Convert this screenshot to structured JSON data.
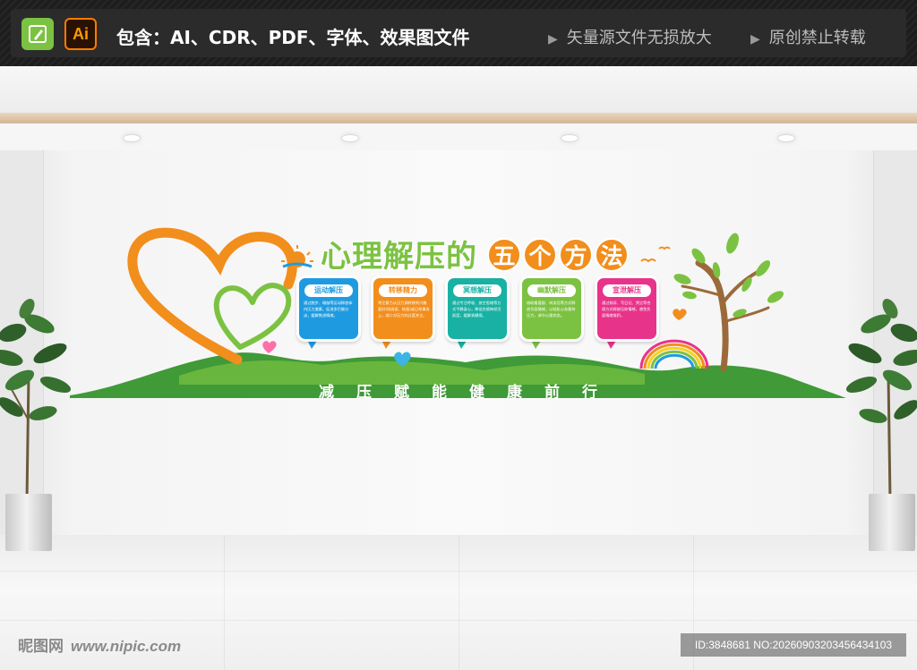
{
  "banner": {
    "ai_icon_label": "Ai",
    "includes_text": "包含：AI、CDR、PDF、字体、效果图文件",
    "note_vector": "矢量源文件无损放大",
    "note_original": "原创禁止转载",
    "note_marker": "▶",
    "icons": [
      "pencil-icon",
      "ai-icon"
    ]
  },
  "wall_art": {
    "title_main": "心理解压的",
    "title_circles": [
      "五",
      "个",
      "方",
      "法"
    ],
    "cards": [
      {
        "title": "运动解压",
        "body": "通过跑步、瑜伽等运动释放体内压力激素，促进多巴胺分泌，缓解焦虑情绪。",
        "color": "#1e9be0"
      },
      {
        "title": "转移精力",
        "body": "将注意力从压力源转移到兴趣爱好(如阅读、绘画)或日常事务上，减少对压力的过度关注。",
        "color": "#f28e1c"
      },
      {
        "title": "冥想解压",
        "body": "通过专注呼吸、放空思绪等方式平静身心，降低交感神经活跃度，缓解紧绷感。",
        "color": "#18b1a3"
      },
      {
        "title": "幽默解压",
        "body": "借助看喜剧、听笑话等方式释放负面情绪，以轻松心态看待压力，调节心理状态。",
        "color": "#7cc242"
      },
      {
        "title": "宣泄解压",
        "body": "通过倾诉、写日记、哭泣等合理方式释放压抑情绪，避免负面情绪堆积。",
        "color": "#e8338a"
      }
    ],
    "slogan": [
      "减",
      "压",
      "赋",
      "能",
      "健",
      "康",
      "前",
      "行"
    ],
    "colors": {
      "green": "#7cc242",
      "dark_green": "#3f9a37",
      "orange": "#f28e1c",
      "blue": "#1e9be0",
      "teal": "#18b1a3",
      "pink": "#e8338a"
    }
  },
  "watermark": {
    "site_name": "昵图网",
    "site_url": "www.nipic.com",
    "id_text": "ID:3848681 NO:20260903203456434103"
  }
}
